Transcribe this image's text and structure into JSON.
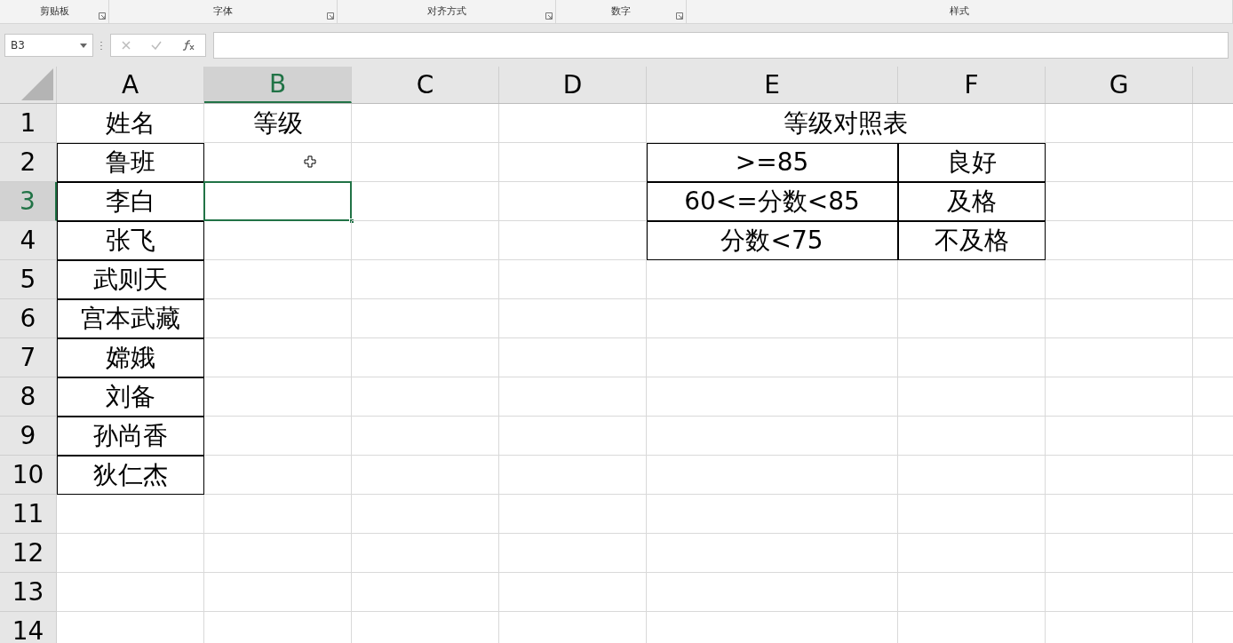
{
  "ribbon_groups": [
    {
      "label": "剪贴板",
      "launcher": true
    },
    {
      "label": "字体",
      "launcher": true
    },
    {
      "label": "对齐方式",
      "launcher": true
    },
    {
      "label": "数字",
      "launcher": true
    },
    {
      "label": "样式",
      "launcher": false
    }
  ],
  "name_box": "B3",
  "columns": [
    {
      "label": "A",
      "selected": false
    },
    {
      "label": "B",
      "selected": true
    },
    {
      "label": "C",
      "selected": false
    },
    {
      "label": "D",
      "selected": false
    },
    {
      "label": "E",
      "selected": false
    },
    {
      "label": "F",
      "selected": false
    },
    {
      "label": "G",
      "selected": false
    }
  ],
  "rows": [
    {
      "label": "1",
      "selected": false,
      "cells": [
        {
          "text": "姓名",
          "bordered": false
        },
        {
          "text": "等级",
          "bordered": false
        },
        {
          "bordered": false
        },
        {
          "bordered": false
        },
        {
          "text": "等级对照表",
          "bordered": false,
          "merged": true
        }
      ]
    },
    {
      "label": "2",
      "selected": false,
      "cells": [
        {
          "text": "鲁班",
          "bordered": true
        },
        {
          "bordered": false,
          "cursor": true
        },
        {
          "bordered": false
        },
        {
          "bordered": false
        },
        {
          "text": ">=85",
          "bordered": true
        },
        {
          "text": "良好",
          "bordered": true
        },
        {
          "bordered": false
        }
      ]
    },
    {
      "label": "3",
      "selected": true,
      "cells": [
        {
          "text": "李白",
          "bordered": true
        },
        {
          "bordered": false,
          "selected": true
        },
        {
          "bordered": false
        },
        {
          "bordered": false
        },
        {
          "text": "60<=分数<85",
          "bordered": true
        },
        {
          "text": "及格",
          "bordered": true
        },
        {
          "bordered": false
        }
      ]
    },
    {
      "label": "4",
      "selected": false,
      "cells": [
        {
          "text": "张飞",
          "bordered": true
        },
        {
          "bordered": false
        },
        {
          "bordered": false
        },
        {
          "bordered": false
        },
        {
          "text": "分数<75",
          "bordered": true
        },
        {
          "text": "不及格",
          "bordered": true
        },
        {
          "bordered": false
        }
      ]
    },
    {
      "label": "5",
      "selected": false,
      "cells": [
        {
          "text": "武则天",
          "bordered": true
        }
      ]
    },
    {
      "label": "6",
      "selected": false,
      "cells": [
        {
          "text": "宫本武藏",
          "bordered": true
        }
      ]
    },
    {
      "label": "7",
      "selected": false,
      "cells": [
        {
          "text": "嫦娥",
          "bordered": true
        }
      ]
    },
    {
      "label": "8",
      "selected": false,
      "cells": [
        {
          "text": "刘备",
          "bordered": true
        }
      ]
    },
    {
      "label": "9",
      "selected": false,
      "cells": [
        {
          "text": "孙尚香",
          "bordered": true
        }
      ]
    },
    {
      "label": "10",
      "selected": false,
      "cells": [
        {
          "text": "狄仁杰",
          "bordered": true
        }
      ]
    },
    {
      "label": "11",
      "selected": false,
      "cells": []
    },
    {
      "label": "12",
      "selected": false,
      "cells": []
    },
    {
      "label": "13",
      "selected": false,
      "cells": []
    },
    {
      "label": "14",
      "selected": false,
      "cells": []
    }
  ]
}
